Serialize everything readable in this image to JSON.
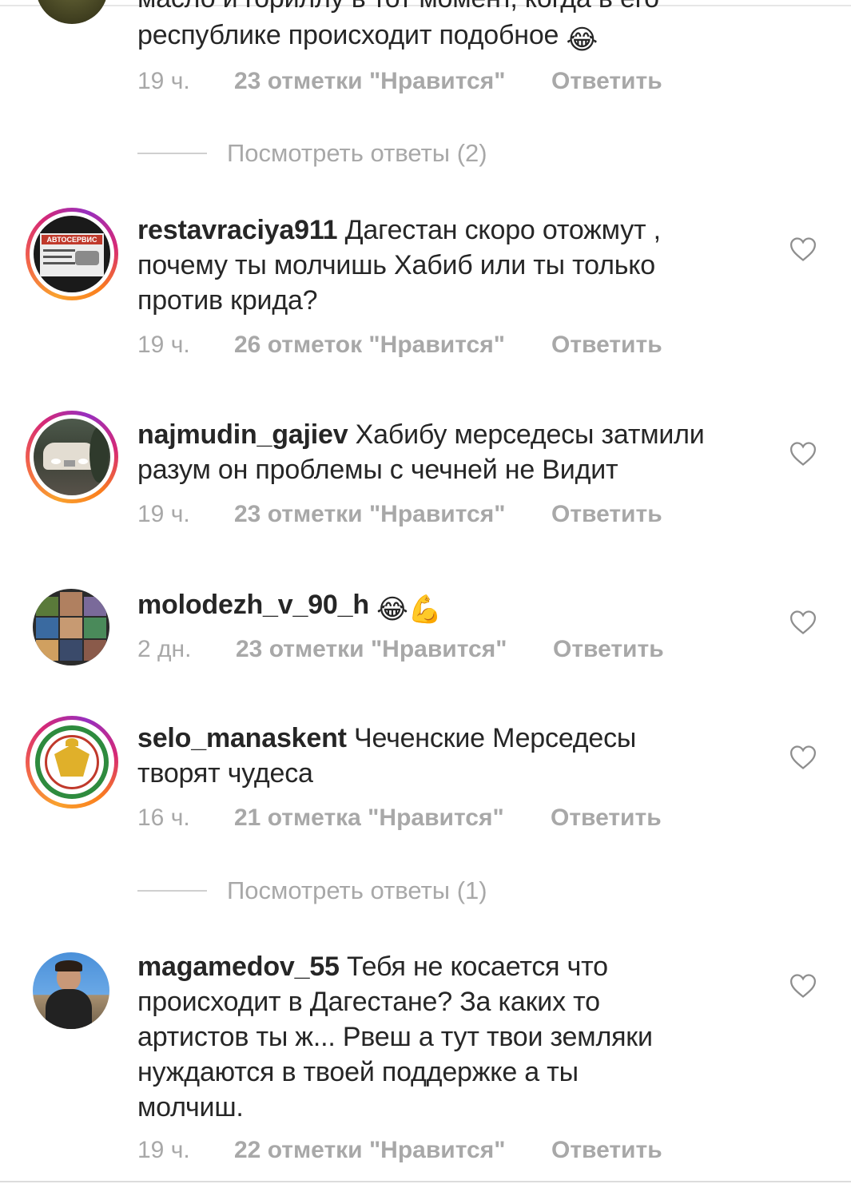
{
  "comments": [
    {
      "username": "",
      "text_partial_top": "масло и гориллу в тот момент, когда в его",
      "text": "республике происходит подобное",
      "emoji": "😂",
      "time": "19 ч.",
      "likes": "23 отметки \"Нравится\"",
      "reply": "Ответить"
    },
    {
      "username": "restavraciya911",
      "text_lines": [
        "Дагестан скоро отожмут ,",
        "почему ты молчишь Хабиб или ты только",
        "против крида?"
      ],
      "time": "19 ч.",
      "likes": "26 отметок \"Нравится\"",
      "reply": "Ответить",
      "avatar_text": "АВТОСЕРВИС"
    },
    {
      "username": "najmudin_gajiev",
      "text_lines": [
        "Хабибу мерседесы затмили",
        "разум он проблемы с чечней не Видит"
      ],
      "time": "19 ч.",
      "likes": "23 отметки \"Нравится\"",
      "reply": "Ответить"
    },
    {
      "username": "molodezh_v_90_h",
      "emoji": "😂💪",
      "time": "2 дн.",
      "likes": "23 отметки \"Нравится\"",
      "reply": "Ответить"
    },
    {
      "username": "selo_manaskent",
      "text_lines": [
        "Чеченские Мерседесы",
        "творят чудеса"
      ],
      "time": "16 ч.",
      "likes": "21 отметка \"Нравится\"",
      "reply": "Ответить"
    },
    {
      "username": "magamedov_55",
      "text_lines": [
        "Тебя не косается что",
        "происходит в Дагестане? За каких то",
        "артистов ты ж... Рвеш а тут твои земляки",
        "нуждаются в твоей поддержке а ты",
        "молчиш."
      ],
      "time": "19 ч.",
      "likes": "22 отметки \"Нравится\"",
      "reply": "Ответить"
    }
  ],
  "view_replies": [
    "Посмотреть ответы (2)",
    "Посмотреть ответы (1)"
  ],
  "colors": {
    "text": "#262626",
    "secondary": "#a8a8a8",
    "divider": "#cfcfcf",
    "ring_start": "#f9a12e",
    "ring_mid": "#d62976",
    "ring_end": "#962fbf"
  },
  "icons": {
    "like": "heart-outline-icon"
  }
}
